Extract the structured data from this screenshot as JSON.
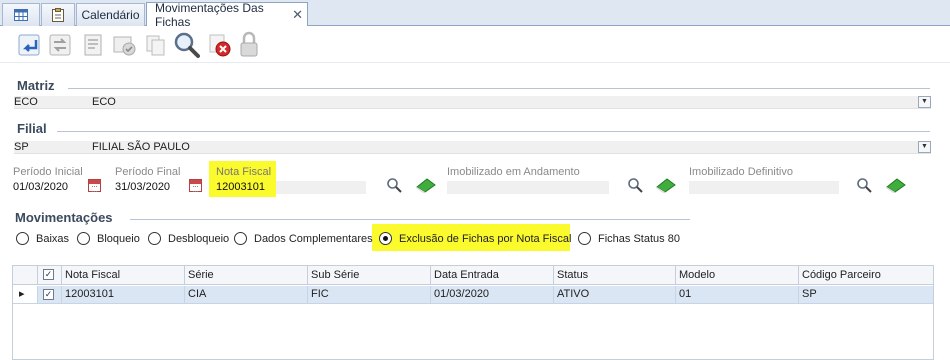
{
  "tabs": {
    "calendario": "Calendário",
    "movimentacoes": "Movimentações Das Fichas",
    "close": "✕"
  },
  "colors": {
    "highlight": "#fafa2c",
    "row_selected": "#dbe6f4",
    "accent": "#3b4a5e"
  },
  "toolbar": {
    "icons": [
      "back-arrow-icon",
      "refresh-icon",
      "document-icon",
      "approve-icon",
      "copy-icon",
      "search-icon",
      "delete-icon",
      "lock-icon"
    ]
  },
  "matriz": {
    "title": "Matriz",
    "code": "ECO",
    "desc": "ECO"
  },
  "filial": {
    "title": "Filial",
    "code": "SP",
    "desc": "FILIAL SÃO PAULO"
  },
  "fields": {
    "periodo_inicial_label": "Período Inicial",
    "periodo_inicial": "01/03/2020",
    "periodo_final_label": "Período Final",
    "periodo_final": "31/03/2020",
    "nota_fiscal_label": "Nota Fiscal",
    "nota_fiscal": "12003101",
    "imob_andamento_label": "Imobilizado em Andamento",
    "imob_definitivo_label": "Imobilizado Definitivo"
  },
  "movimentacoes": {
    "title": "Movimentações",
    "options": [
      "Baixas",
      "Bloqueio",
      "Desbloqueio",
      "Dados Complementares",
      "Exclusão de Fichas por Nota Fiscal",
      "Fichas Status 80"
    ],
    "selected": "Exclusão de Fichas por Nota Fiscal"
  },
  "grid": {
    "columns": [
      "Nota Fiscal",
      "Série",
      "Sub Série",
      "Data Entrada",
      "Status",
      "Modelo",
      "Código Parceiro"
    ],
    "rows": [
      {
        "nota_fiscal": "12003101",
        "serie": "CIA",
        "sub_serie": "FIC",
        "data_entrada": "01/03/2020",
        "status": "ATIVO",
        "modelo": "01",
        "codigo_parceiro": "SP"
      }
    ],
    "check": "✓",
    "row_indicator": "▸"
  }
}
